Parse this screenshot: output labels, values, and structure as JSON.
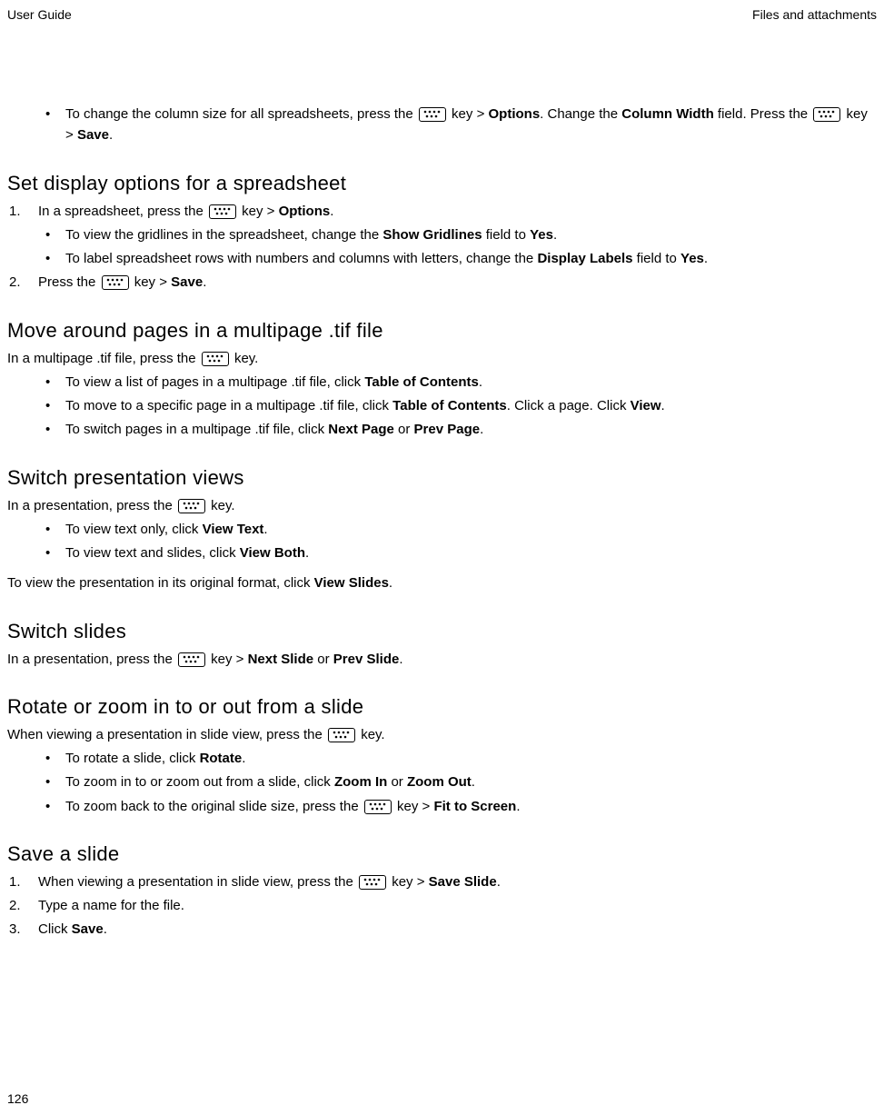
{
  "header": {
    "left": "User Guide",
    "right": "Files and attachments"
  },
  "intro_bullet": {
    "t1": "To change the column size for all spreadsheets, press the ",
    "t2": " key > ",
    "options": "Options",
    "t3": ". Change the ",
    "column_width": "Column Width",
    "t4": " field. Press the ",
    "t5": " key > ",
    "save": "Save",
    "t6": "."
  },
  "sec1": {
    "title": "Set display options for a spreadsheet",
    "step1": {
      "num": "1.",
      "t1": "In a spreadsheet, press the ",
      "t2": " key > ",
      "options": "Options",
      "t3": "."
    },
    "b1": {
      "t1": "To view the gridlines in the spreadsheet, change the ",
      "show_gridlines": "Show Gridlines",
      "t2": " field to ",
      "yes": "Yes",
      "t3": "."
    },
    "b2": {
      "t1": "To label spreadsheet rows with numbers and columns with letters, change the ",
      "display_labels": "Display Labels",
      "t2": " field to ",
      "yes": "Yes",
      "t3": "."
    },
    "step2": {
      "num": "2.",
      "t1": "Press the ",
      "t2": " key > ",
      "save": "Save",
      "t3": "."
    }
  },
  "sec2": {
    "title": "Move around pages in a multipage .tif file",
    "intro": {
      "t1": "In a multipage .tif file, press the ",
      "t2": " key."
    },
    "b1": {
      "t1": "To view a list of pages in a multipage .tif file, click ",
      "toc": "Table of Contents",
      "t2": "."
    },
    "b2": {
      "t1": "To move to a specific page in a multipage .tif file, click ",
      "toc": "Table of Contents",
      "t2": ". Click a page. Click ",
      "view": "View",
      "t3": "."
    },
    "b3": {
      "t1": "To switch pages in a multipage .tif file, click ",
      "next": "Next Page",
      "t2": " or ",
      "prev": "Prev Page",
      "t3": "."
    }
  },
  "sec3": {
    "title": "Switch presentation views",
    "intro": {
      "t1": "In a presentation, press the ",
      "t2": " key."
    },
    "b1": {
      "t1": "To view text only, click ",
      "view_text": "View Text",
      "t2": "."
    },
    "b2": {
      "t1": "To view text and slides, click ",
      "view_both": "View Both",
      "t2": "."
    },
    "outro": {
      "t1": "To view the presentation in its original format, click ",
      "view_slides": "View Slides",
      "t2": "."
    }
  },
  "sec4": {
    "title": "Switch slides",
    "p": {
      "t1": "In a presentation, press the ",
      "t2": " key > ",
      "next": "Next Slide",
      "t3": " or ",
      "prev": "Prev Slide",
      "t4": "."
    }
  },
  "sec5": {
    "title": "Rotate or zoom in to or out from a slide",
    "intro": {
      "t1": "When viewing a presentation in slide view, press the ",
      "t2": " key."
    },
    "b1": {
      "t1": "To rotate a slide, click ",
      "rotate": "Rotate",
      "t2": "."
    },
    "b2": {
      "t1": "To zoom in to or zoom out from a slide, click ",
      "zoom_in": "Zoom In",
      "t2": " or ",
      "zoom_out": "Zoom Out",
      "t3": "."
    },
    "b3": {
      "t1": "To zoom back to the original slide size, press the ",
      "t2": " key > ",
      "fit": "Fit to Screen",
      "t3": "."
    }
  },
  "sec6": {
    "title": "Save a slide",
    "s1": {
      "num": "1.",
      "t1": "When viewing a presentation in slide view, press the ",
      "t2": " key > ",
      "save_slide": "Save Slide",
      "t3": "."
    },
    "s2": {
      "num": "2.",
      "t1": "Type a name for the file."
    },
    "s3": {
      "num": "3.",
      "t1": "Click ",
      "save": "Save",
      "t2": "."
    }
  },
  "footer": {
    "page": "126"
  }
}
